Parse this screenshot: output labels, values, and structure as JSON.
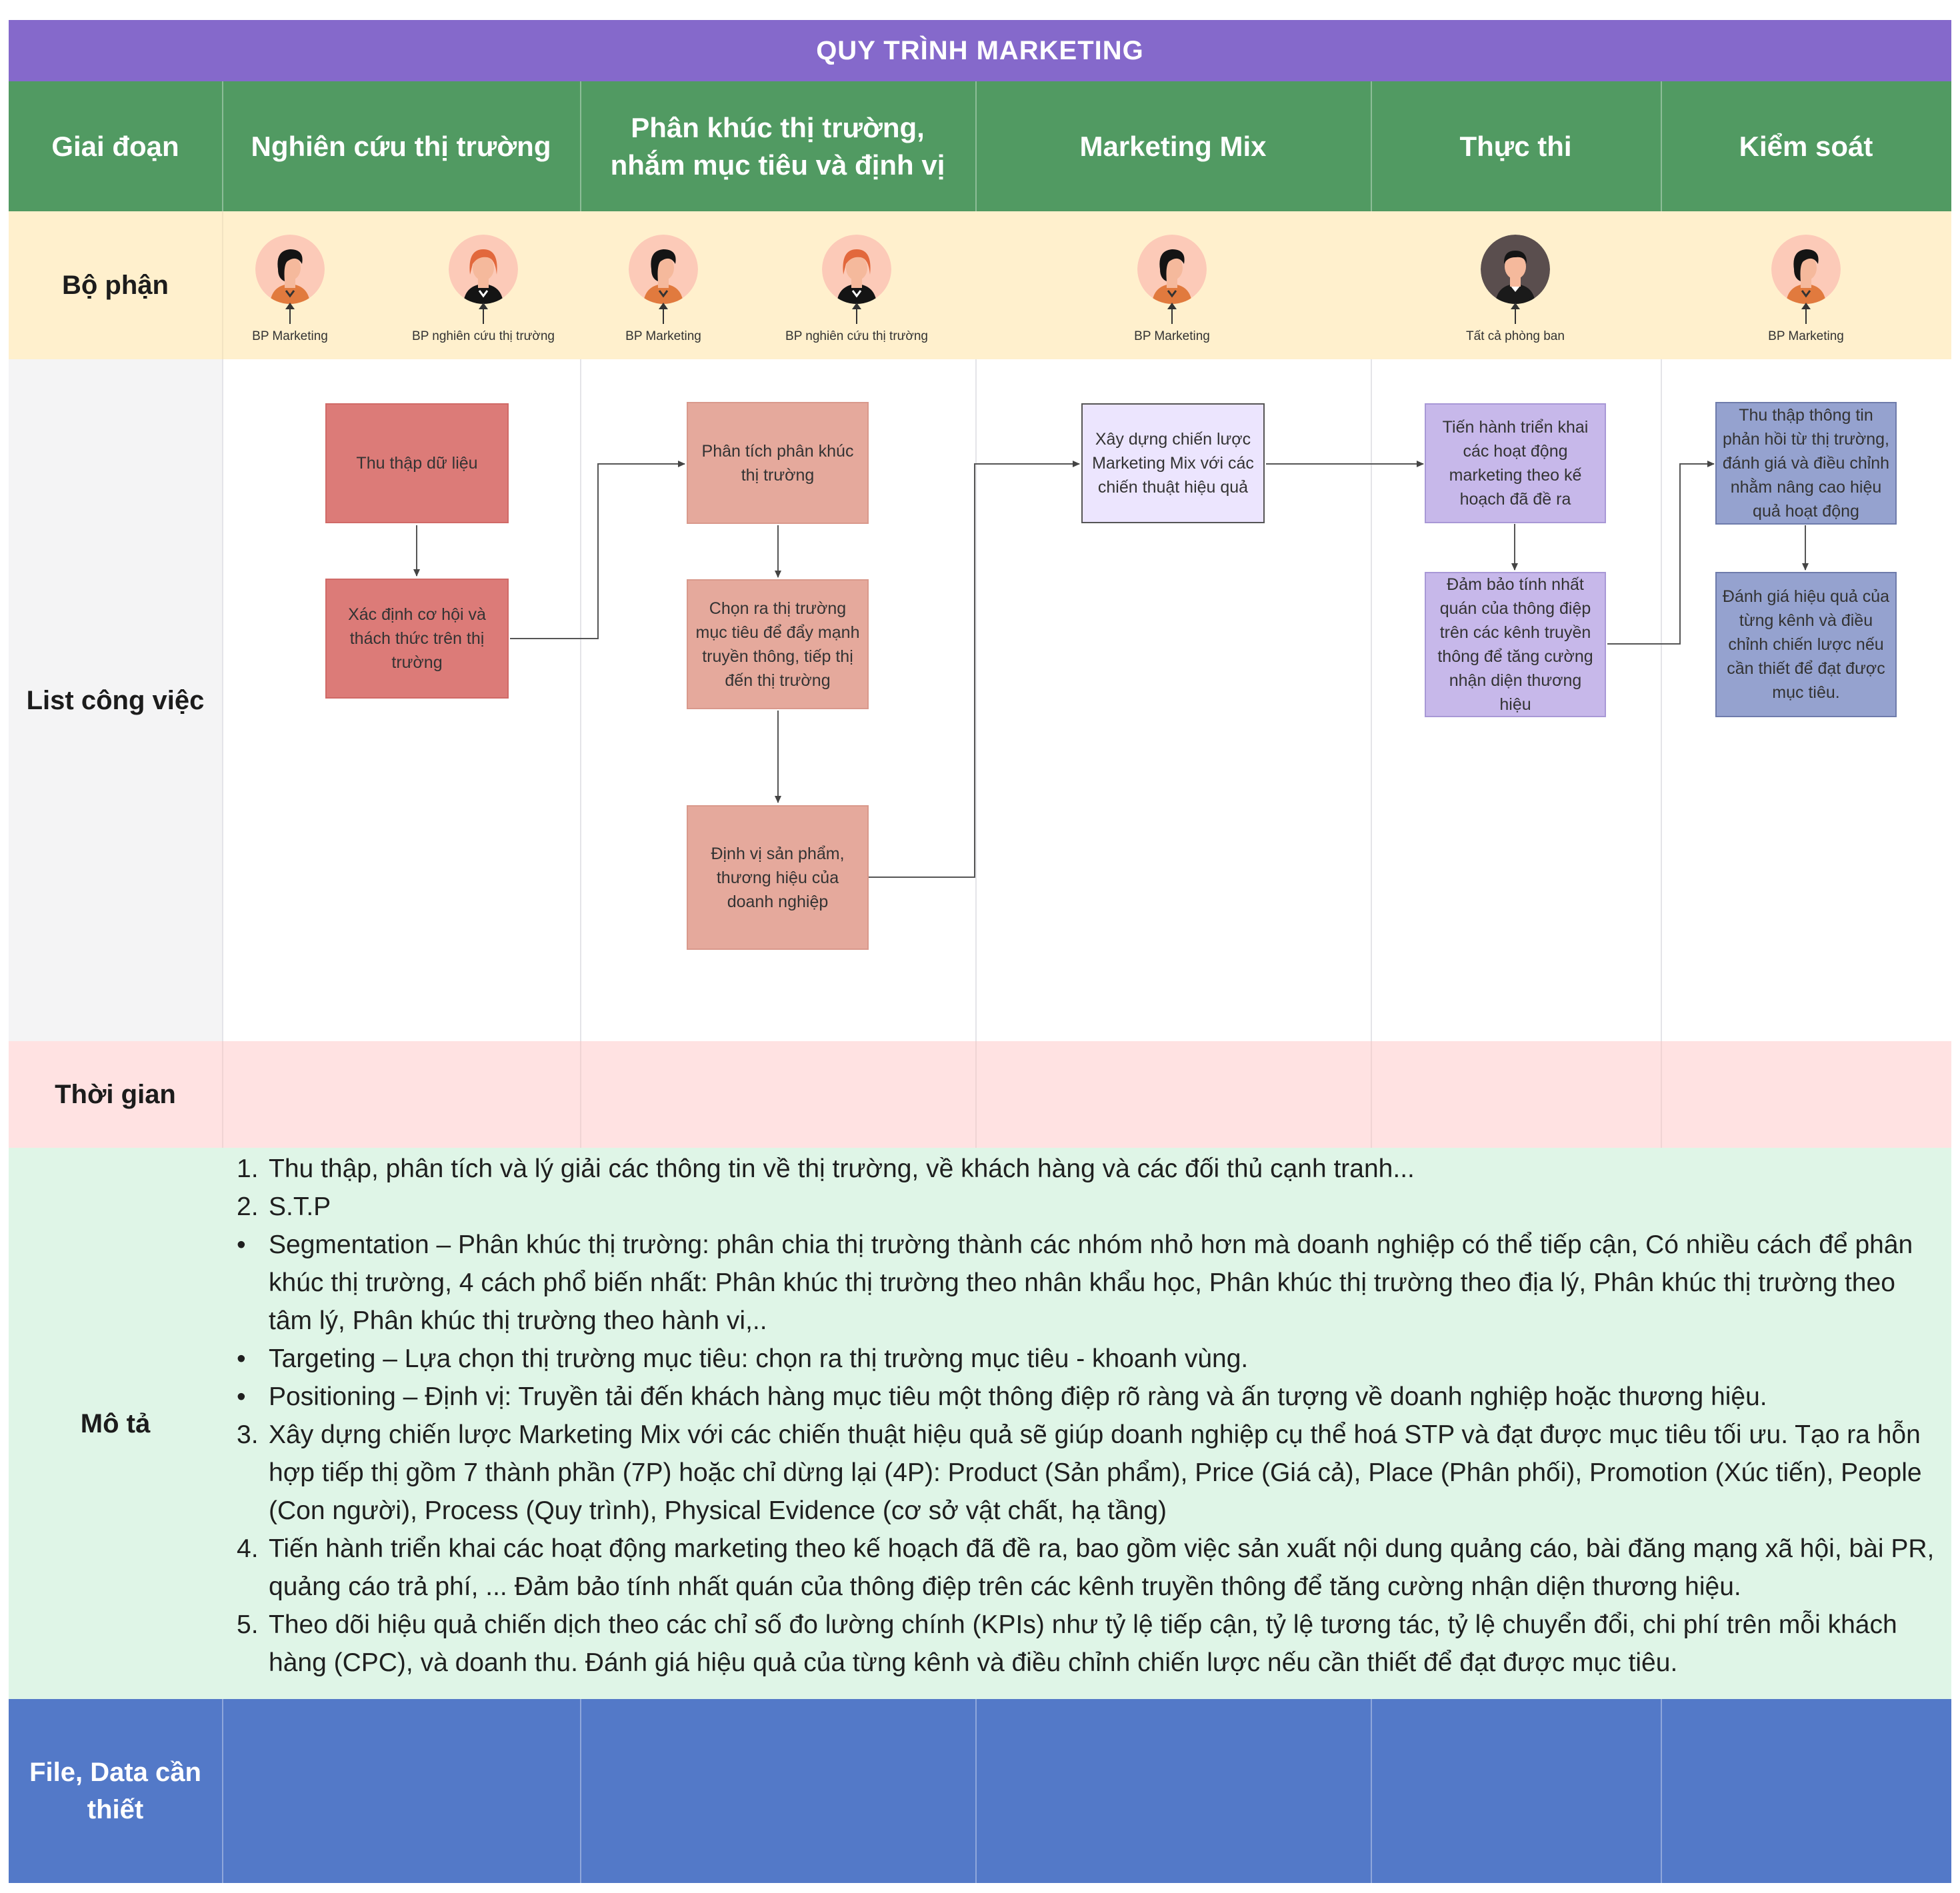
{
  "title": "QUY TRÌNH MARKETING",
  "header": {
    "label": "Giai đoạn",
    "phases": [
      "Nghiên cứu thị trường",
      "Phân khúc thị trường, nhắm mục tiêu và định vị",
      "Marketing Mix",
      "Thực thi",
      "Kiểm soát"
    ]
  },
  "rows": {
    "department": "Bộ phận",
    "tasks": "List công việc",
    "time": "Thời gian",
    "description": "Mô tả",
    "files": "File, Data cần thiết"
  },
  "departments": [
    {
      "label": "BP Marketing",
      "avatar": "woman-black-hair-avatar"
    },
    {
      "label": "BP nghiên cứu thị trường",
      "avatar": "woman-red-hair-avatar"
    },
    {
      "label": "BP Marketing",
      "avatar": "woman-black-hair-avatar"
    },
    {
      "label": "BP nghiên cứu thị trường",
      "avatar": "woman-red-hair-avatar"
    },
    {
      "label": "BP Marketing",
      "avatar": "woman-black-hair-avatar"
    },
    {
      "label": "Tất cả phòng ban",
      "avatar": "man-dark-avatar"
    },
    {
      "label": "BP Marketing",
      "avatar": "woman-black-hair-avatar"
    }
  ],
  "tasks": {
    "research_1": "Thu thập dữ liệu",
    "research_2": "Xác định cơ hội và thách thức trên thị trường",
    "stp_1": "Phân tích phân khúc thị trường",
    "stp_2": "Chọn ra thị trường mục tiêu để đẩy mạnh truyền thông, tiếp thị đến thị trường",
    "stp_3": "Định vị sản phẩm, thương hiệu của doanh nghiệp",
    "mix_1": "Xây dựng chiến lược Marketing Mix với các chiến thuật hiệu quả",
    "exec_1": "Tiến hành triển khai các hoạt động marketing theo kế hoạch đã đề ra",
    "exec_2": "Đảm bảo tính nhất quán của thông điệp trên các kênh truyền thông để tăng cường nhận diện thương hiệu",
    "control_1": "Thu thập thông tin phản hồi từ thị trường, đánh giá và điều chỉnh nhằm nâng cao hiệu quả hoạt động",
    "control_2": "Đánh giá hiệu quả của từng kênh và điều chỉnh chiến lược nếu cần thiết để đạt được mục tiêu."
  },
  "description": [
    {
      "marker": "1.",
      "text": "Thu thập, phân tích và lý giải các thông tin về thị trường, về khách hàng và các đối thủ cạnh tranh..."
    },
    {
      "marker": "2.",
      "text": "S.T.P"
    },
    {
      "marker": "•",
      "text": "Segmentation – Phân khúc thị trường: phân chia thị trường thành các nhóm nhỏ hơn mà doanh nghiệp có thể tiếp cận, Có nhiều cách để phân khúc thị trường, 4 cách phổ biến nhất: Phân khúc thị trường theo nhân khẩu học, Phân khúc thị trường theo địa lý, Phân khúc thị trường theo tâm lý, Phân khúc thị trường theo hành vi,.."
    },
    {
      "marker": "•",
      "text": "Targeting – Lựa chọn thị trường mục tiêu: chọn ra thị trường mục tiêu - khoanh vùng."
    },
    {
      "marker": "•",
      "text": "Positioning – Định vị: Truyền tải đến khách hàng mục tiêu một thông điệp rõ ràng và ấn tượng về doanh nghiệp hoặc thương hiệu."
    },
    {
      "marker": "3.",
      "text": "Xây dựng chiến lược Marketing Mix với các chiến thuật hiệu quả sẽ giúp doanh nghiệp cụ thể hoá STP và  đạt được mục tiêu tối ưu. Tạo ra hỗn hợp tiếp thị gồm 7 thành phần (7P) hoặc chỉ dừng lại (4P): Product (Sản phẩm), Price (Giá cả), Place (Phân phối), Promotion (Xúc tiến), People (Con người), Process (Quy trình), Physical Evidence (cơ sở vật chất, hạ tầng)"
    },
    {
      "marker": "4.",
      "text": "Tiến hành triển khai các hoạt động marketing theo kế hoạch đã đề ra, bao gồm việc sản xuất nội dung quảng cáo, bài đăng mạng xã hội, bài PR, quảng cáo trả phí, ... Đảm bảo tính nhất quán của thông điệp trên các kênh truyền thông để tăng cường nhận diện thương hiệu."
    },
    {
      "marker": "5.",
      "text": "Theo dõi hiệu quả chiến dịch theo các chỉ số đo lường chính (KPIs) như tỷ lệ tiếp cận, tỷ lệ tương tác, tỷ lệ chuyển đổi, chi phí trên mỗi khách hàng (CPC), và doanh thu. Đánh giá hiệu quả của từng kênh và điều chỉnh chiến lược nếu cần thiết để đạt được mục tiêu."
    }
  ],
  "colors": {
    "title": "#8569CB",
    "header": "#519A62",
    "department": "#FFF0CD",
    "time": "#FFE2E2",
    "description": "#DFF5E7",
    "files": "#5379C8"
  }
}
